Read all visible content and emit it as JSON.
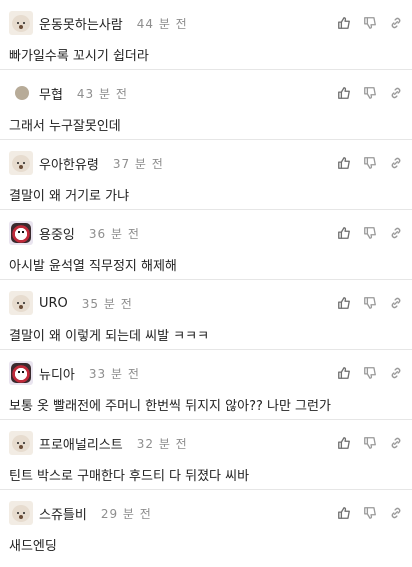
{
  "comments": [
    {
      "author": "운동못하는사람",
      "time": "44 분 전",
      "text": "빠가일수록 꼬시기 쉽더라",
      "avatar": "dog-avatar"
    },
    {
      "author": "무협",
      "time": "43 분 전",
      "text": "그래서 누구잘못인데",
      "avatar": "dot-avatar"
    },
    {
      "author": "우아한유령",
      "time": "37 분 전",
      "text": "결말이 왜 거기로 가냐",
      "avatar": "dog-avatar"
    },
    {
      "author": "용중잉",
      "time": "36 분 전",
      "text": "아시발 윤석열 직무정지 해제해",
      "avatar": "mask-avatar"
    },
    {
      "author": "URO",
      "time": "35 분 전",
      "text": "결말이 왜 이렇게 되는데 씨발 ㅋㅋㅋ",
      "avatar": "dog-avatar"
    },
    {
      "author": "뉴디아",
      "time": "33 분 전",
      "text": "보통 옷 빨래전에 주머니 한번씩 뒤지지 않아?? 나만 그런가",
      "avatar": "mask-avatar"
    },
    {
      "author": "프로애널리스트",
      "time": "32 분 전",
      "text": "틴트 박스로 구매한다 후드티 다 뒤졌다 씨바",
      "avatar": "dog-avatar"
    },
    {
      "author": "스쥬틀비",
      "time": "29 분 전",
      "text": "새드엔딩",
      "avatar": "dog-avatar"
    }
  ],
  "icons": {
    "like": "thumbs-up-icon",
    "dislike": "thumbs-down-icon",
    "share": "link-icon"
  },
  "colors": {
    "text": "#222222",
    "time": "#8e8e8e",
    "divider": "#e6e6e6",
    "icon": "#7a7a7a"
  }
}
